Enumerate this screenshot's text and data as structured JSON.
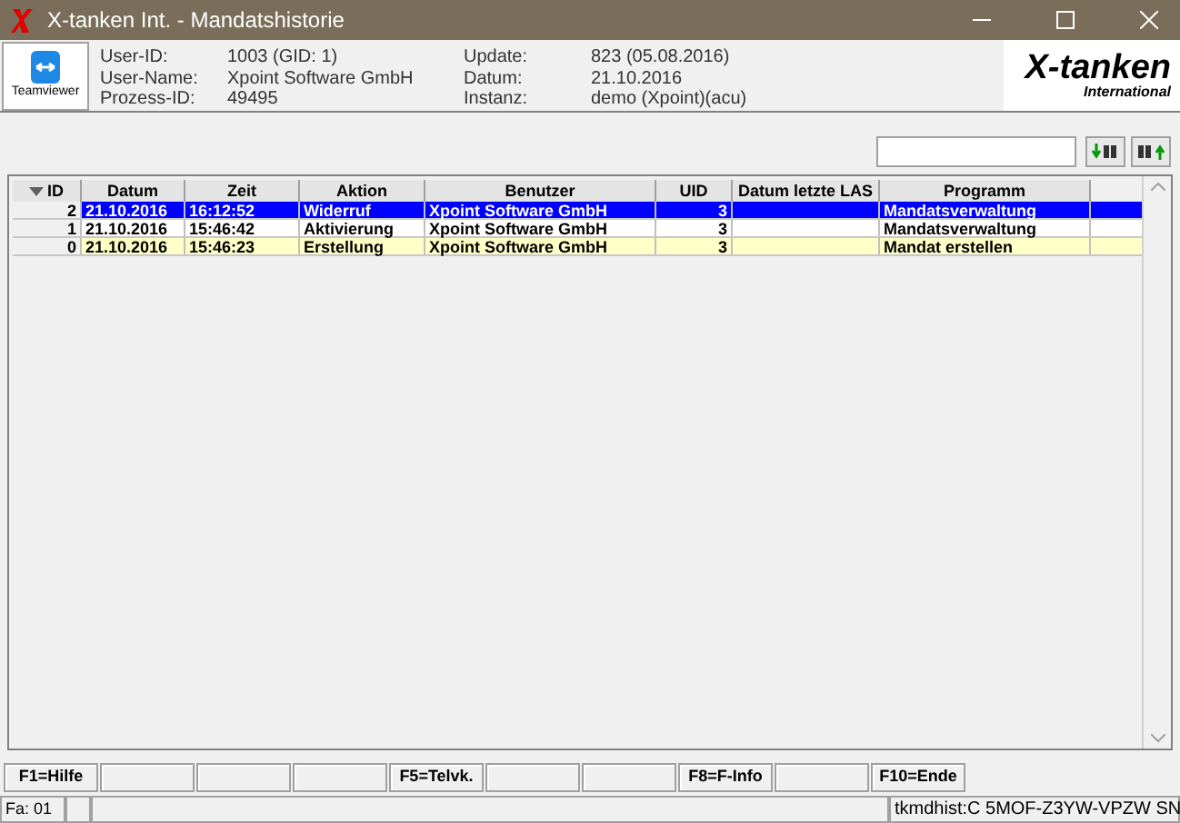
{
  "window": {
    "title": "X-tanken Int. - Mandatshistorie"
  },
  "header": {
    "teamviewer": "Teamviewer",
    "fields": [
      {
        "label": "User-ID:",
        "value": "1003 (GID: 1)"
      },
      {
        "label": "User-Name:",
        "value": "Xpoint Software GmbH"
      },
      {
        "label": "Prozess-ID:",
        "value": "49495"
      },
      {
        "label": "Update:",
        "value": "823 (05.08.2016)"
      },
      {
        "label": "Datum:",
        "value": "21.10.2016"
      },
      {
        "label": "Instanz:",
        "value": "demo (Xpoint)(acu)"
      }
    ],
    "logo": {
      "main": "X-tanken",
      "sub": "International"
    }
  },
  "table": {
    "columns": [
      "ID",
      "Datum",
      "Zeit",
      "Aktion",
      "Benutzer",
      "UID",
      "Datum letzte LAS",
      "Programm"
    ],
    "rows": [
      {
        "selected": true,
        "cells": [
          "2",
          "21.10.2016",
          "16:12:52",
          "Widerruf",
          "Xpoint Software GmbH",
          "3",
          "",
          "Mandatsverwaltung"
        ]
      },
      {
        "selected": false,
        "color": "#ffffff",
        "cells": [
          "1",
          "21.10.2016",
          "15:46:42",
          "Aktivierung",
          "Xpoint Software GmbH",
          "3",
          "",
          "Mandatsverwaltung"
        ]
      },
      {
        "selected": false,
        "color": "#ffffc8",
        "cells": [
          "0",
          "21.10.2016",
          "15:46:23",
          "Erstellung",
          "Xpoint Software GmbH",
          "3",
          "",
          "Mandat erstellen"
        ]
      }
    ]
  },
  "function_keys": [
    {
      "kind": "key",
      "label": "F1=Hilfe"
    },
    {
      "kind": "blank"
    },
    {
      "kind": "blank"
    },
    {
      "kind": "blank"
    },
    {
      "kind": "key",
      "label": "F5=Telvk."
    },
    {
      "kind": "blank"
    },
    {
      "kind": "blank"
    },
    {
      "kind": "key",
      "label": "F8=F-Info"
    },
    {
      "kind": "blank"
    },
    {
      "kind": "key",
      "label": "F10=Ende"
    }
  ],
  "status_bar": {
    "left": "Fa: 01",
    "right": "tkmdhist:C 5MOF-Z3YW-VPZW SN"
  }
}
